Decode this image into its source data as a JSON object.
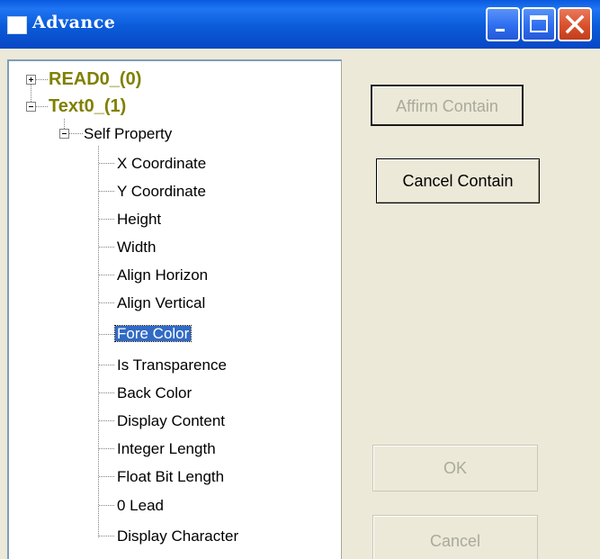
{
  "window": {
    "title": "Advance"
  },
  "titlebar": {
    "minimize_icon": "minimize-icon",
    "maximize_icon": "maximize-icon",
    "close_icon": "close-icon"
  },
  "tree": {
    "roots": [
      {
        "label": "READ0_(0)",
        "expanded": false
      },
      {
        "label": "Text0_(1)",
        "expanded": true
      }
    ],
    "group": {
      "label": "Self Property",
      "expanded": true
    },
    "items": [
      "X Coordinate",
      "Y Coordinate",
      "Height",
      "Width",
      "Align Horizon",
      "Align Vertical",
      "Fore Color",
      "Is Transparence",
      "Back Color",
      "Display Content",
      "Integer Length",
      "Float Bit Length",
      "0 Lead",
      "Display Character"
    ],
    "selected_item": "Fore Color"
  },
  "buttons": {
    "affirm_contain": {
      "label": "Affirm Contain",
      "enabled": false
    },
    "cancel_contain": {
      "label": "Cancel Contain",
      "enabled": true
    },
    "ok": {
      "label": "OK",
      "enabled": false
    },
    "cancel": {
      "label": "Cancel",
      "enabled": false
    }
  },
  "colors": {
    "titlebar": "#0a5ae0",
    "root_text": "#808000",
    "selection": "#316ac5",
    "window_bg": "#ece9d8"
  }
}
